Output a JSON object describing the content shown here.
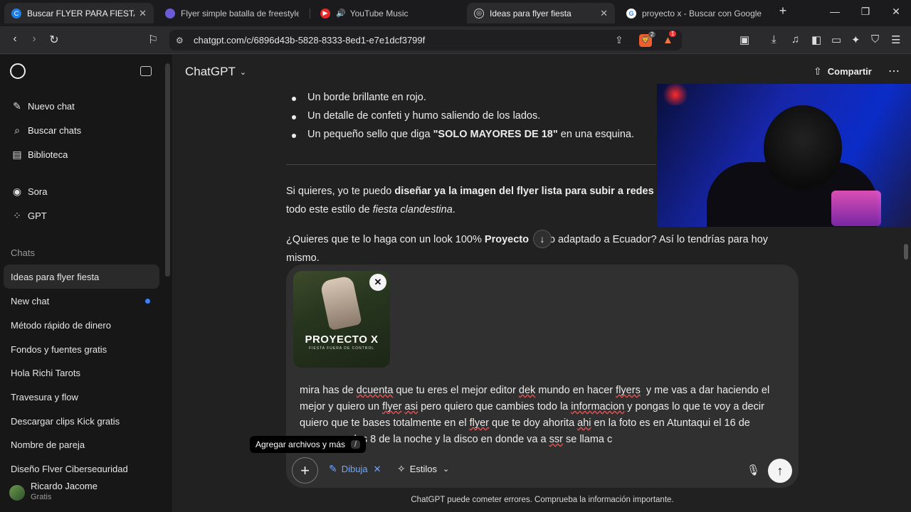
{
  "browser": {
    "tabs": [
      {
        "title": "Buscar FLYER PARA FIESTA - C",
        "active": true
      },
      {
        "title": "Flyer simple batalla de freestyle na",
        "active": false
      },
      {
        "title": "YouTube Music",
        "active": false
      },
      {
        "title": "Ideas para flyer fiesta",
        "active": true
      },
      {
        "title": "proyecto x - Buscar con Google",
        "active": false
      }
    ],
    "new_tab": "+",
    "url": "chatgpt.com/c/6896d43b-5828-8333-8ed1-e7e1dcf3799f",
    "brave_badge": "2",
    "rewards_badge": "1"
  },
  "sidebar": {
    "actions": [
      {
        "label": "Nuevo chat",
        "icon": "edit-icon"
      },
      {
        "label": "Buscar chats",
        "icon": "search-icon"
      },
      {
        "label": "Biblioteca",
        "icon": "library-icon"
      },
      {
        "label": "Sora",
        "icon": "sora-icon"
      },
      {
        "label": "GPT",
        "icon": "gpt-icon"
      }
    ],
    "chats_header": "Chats",
    "chats": [
      "Ideas para flyer fiesta",
      "New chat",
      "Método rápido de dinero",
      "Fondos y fuentes gratis",
      "Hola Richi Tarots",
      "Travesura y flow",
      "Descargar clips Kick gratis",
      "Nombre de pareja",
      "Diseño Flyer Ciberseguridad"
    ],
    "user": {
      "name": "Ricardo Jacome",
      "plan": "Gratis"
    }
  },
  "header": {
    "model": "ChatGPT",
    "share": "Compartir",
    "more": "⋯"
  },
  "conversation": {
    "bullets": [
      {
        "pre": "Un borde brillante en rojo.",
        "bold": "",
        "post": ""
      },
      {
        "pre": "Un detalle de confeti y humo saliendo de los lados.",
        "bold": "",
        "post": ""
      },
      {
        "pre": "Un pequeño sello que diga ",
        "bold": "\"SOLO MAYORES DE 18\"",
        "post": " en una esquina."
      }
    ],
    "p1_pre": "Si quieres, yo te puedo ",
    "p1_bold": "diseñar ya la imagen del flyer lista para subir a redes c",
    "p1_line2_pre": "todo este estilo de ",
    "p1_line2_italic": "fiesta clandestina",
    "p1_line2_post": ".",
    "p2_pre": "¿Quieres que te lo haga con un look 100% ",
    "p2_bold": "Proyecto ",
    "p2_post": "ero adaptado a Ecuador? Así lo tendrías para hoy",
    "p2_line2": "mismo."
  },
  "composer": {
    "attachment_title": "PROYECTO X",
    "attachment_subtitle": "FIESTA FUERA DE CONTROL",
    "message_lines": [
      [
        {
          "t": "mira has de "
        },
        {
          "t": "dcuenta",
          "err": true
        },
        {
          "t": " que tu eres el mejor editor "
        },
        {
          "t": "dek",
          "err": true
        },
        {
          "t": " mundo en hacer "
        },
        {
          "t": "flyers",
          "err": true
        },
        {
          "t": "  y me vas a dar haciendo el"
        }
      ],
      [
        {
          "t": "mejor y quiero un "
        },
        {
          "t": "flyer",
          "err": true
        },
        {
          "t": " "
        },
        {
          "t": "asi",
          "err": true
        },
        {
          "t": " pero quiero que cambies todo la "
        },
        {
          "t": "informacion",
          "err": true
        },
        {
          "t": " y pongas lo que te voy a decir"
        }
      ],
      [
        {
          "t": "quiero que te bases totalmente en el "
        },
        {
          "t": "flyer",
          "err": true
        },
        {
          "t": " que te doy ahorita "
        },
        {
          "t": "ahi",
          "err": true
        },
        {
          "t": " en la foto es en Atuntaqui el 16 de"
        }
      ],
      [
        {
          "t": "                   las 8 de la noche y la disco en donde va a "
        },
        {
          "t": "ssr",
          "err": true
        },
        {
          "t": " se llama c"
        }
      ]
    ],
    "tooltip": "Agregar archivos y más",
    "tooltip_key": "/",
    "tool_draw": "Dibuja",
    "tool_styles": "Estilos"
  },
  "disclaimer": "ChatGPT puede cometer errores. Comprueba la información importante."
}
